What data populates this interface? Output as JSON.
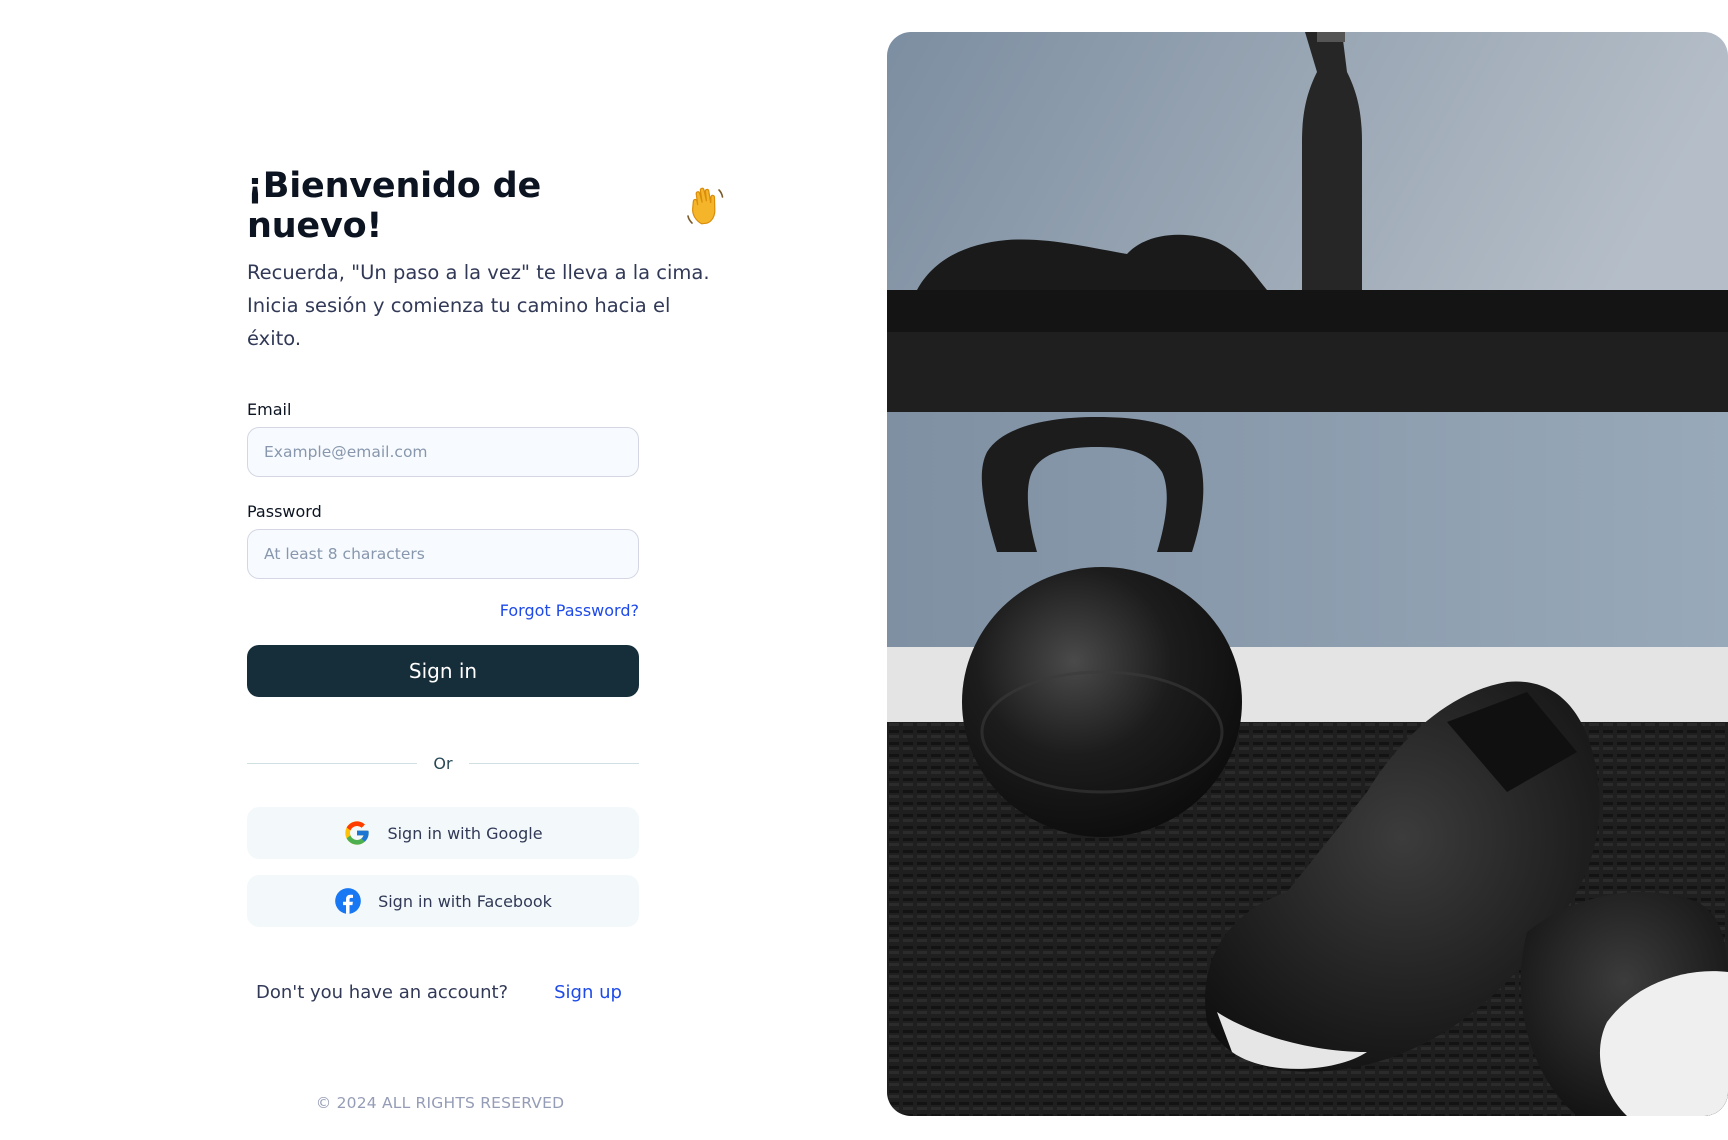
{
  "heading": {
    "title": "¡Bienvenido de nuevo!",
    "emoji_icon": "waving-hand-icon"
  },
  "subtitle": {
    "line1": "Recuerda, \"Un paso a la vez\" te lleva a la cima.",
    "line2": "Inicia sesión y comienza tu camino hacia el éxito."
  },
  "form": {
    "email_label": "Email",
    "email_placeholder": "Example@email.com",
    "email_value": "",
    "password_label": "Password",
    "password_placeholder": "At least 8 characters",
    "password_value": "",
    "forgot_label": "Forgot Password?",
    "signin_label": "Sign in"
  },
  "divider": {
    "label": "Or"
  },
  "social": {
    "google_label": "Sign in with Google",
    "facebook_label": "Sign in with Facebook"
  },
  "signup": {
    "prompt": "Don't you have an account?",
    "link_label": "Sign up"
  },
  "footer": {
    "text": "© 2024 ALL RIGHTS RESERVED"
  },
  "colors": {
    "primary_button": "#162d3a",
    "link": "#1e4ae9",
    "input_bg": "#f7fbff",
    "social_bg": "#f3f9fa"
  },
  "hero_image": {
    "subject": "black kettlebell and boxing gloves on gym floor mat, water bottle on shelf"
  }
}
